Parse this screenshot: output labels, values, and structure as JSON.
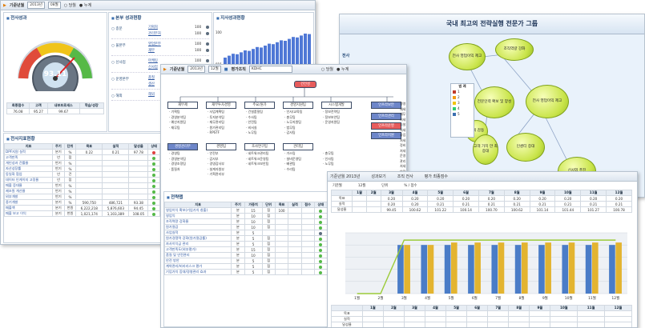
{
  "win1": {
    "header": {
      "label": "기준년월",
      "year": "2013년",
      "month": "08월",
      "opt_unit": "당월",
      "opt_cum": "누계"
    },
    "gauge_title": "전사성과",
    "gauge_value": "93.11",
    "gauge_table": {
      "headers": [
        "최종점수",
        "고객",
        "내부프로세스",
        "학습/성장"
      ],
      "values": [
        "76.08",
        "95.27",
        "99.67",
        ""
      ]
    },
    "dept_title": "본부 성과현황",
    "depts": [
      {
        "name": "○ 종문",
        "rows": [
          {
            "name": "기획처",
            "score": "100"
          },
          {
            "name": "관리부처",
            "score": "100"
          }
        ]
      },
      {
        "name": "○ 울본부",
        "rows": [
          {
            "name": "영업본부",
            "score": "100"
          },
          {
            "name": "재무",
            "score": "100"
          }
        ]
      },
      {
        "name": "○ 신사업",
        "rows": [
          {
            "name": "마케팅",
            "score": "100"
          },
          {
            "name": "신사업",
            "score": "100"
          }
        ]
      },
      {
        "name": "○ 운영본부",
        "rows": [
          {
            "name": "품질",
            "score": "100"
          },
          {
            "name": "생산",
            "score": "100"
          }
        ]
      },
      {
        "name": "○ 해외",
        "rows": [
          {
            "name": "해외",
            "score": "100"
          }
        ]
      }
    ],
    "trend_title": "지사성과현황",
    "trend_ymax": "100",
    "trend_ymin": "815",
    "kpi_title": "전사지표현황",
    "kpi_headers": [
      "지표",
      "주기",
      "단위",
      "목표",
      "실적",
      "달성율",
      "상태"
    ],
    "kpi_rows": [
      [
        "DPF지원 실적",
        "분기",
        "%",
        "0.22",
        "0.21",
        "97.78",
        "r"
      ],
      [
        "고객만족",
        "년",
        "점",
        "",
        "",
        "",
        "g"
      ],
      [
        "개인성과 건률율",
        "반기",
        "%",
        "",
        "",
        "",
        "g"
      ],
      [
        "자산성장률",
        "반기",
        "%",
        "",
        "",
        "",
        "g"
      ],
      [
        "동일화 협업",
        "년",
        "건",
        "",
        "",
        "",
        "g"
      ],
      [
        "데이터 인게이지 고정율",
        "년",
        "점",
        "",
        "",
        "",
        "g"
      ],
      [
        "매출 증대율",
        "반기",
        "%",
        "",
        "",
        "",
        "g"
      ],
      [
        "제조원 개선율",
        "반기",
        "%",
        "",
        "",
        "",
        "g"
      ],
      [
        "외부개발",
        "반기",
        "%",
        "",
        "",
        "",
        "g"
      ],
      [
        "중기개발",
        "분기",
        "%",
        "590,750",
        "486,721",
        "93.38",
        "g"
      ],
      [
        "매출액",
        "분기",
        "천원",
        "6,222,218",
        "5,876,603",
        "94.45",
        "g"
      ],
      [
        "매출 보고 이익",
        "분기",
        "천원",
        "1,021,174",
        "1,103,389",
        "108.05",
        "g"
      ]
    ]
  },
  "win2": {
    "title": "국내 최고의 전략실행 전문가 그룹",
    "side_label": "전사",
    "legend_title": "범 례",
    "legend_items": [
      "1",
      "2",
      "3",
      "4",
      "5"
    ],
    "nodes": [
      "전사 영업이익 제고",
      "조직역량 강화",
      "전문인력 확보 및 양성",
      "전사 영업이익 제고",
      "고객 감동",
      "고객 가치 만 최 증대",
      "인센티 증대",
      "고객의 전 증대",
      "신사업 추진"
    ]
  },
  "win3": {
    "header": {
      "label": "기준년월",
      "year": "2013년",
      "month": "12월",
      "org_label": "평가조직",
      "org": "KDHC",
      "opt_unit": "당월",
      "opt_cum": "누계"
    },
    "root": "건전성",
    "col_heads": [
      "재무제",
      "재무투자경영",
      "주요/원가",
      "경영지원팀",
      "시스템개발",
      "인프라보안"
    ],
    "col_items": [
      [
        "· 기획팀",
        "· 경영분석팀",
        "· 예산지원팀",
        "· 재무팀"
      ],
      [
        "· 사업계획팀",
        "· 투자분석팀",
        "· 재무관리팀",
        "· 원가관리팀",
        "· RPSTF"
      ],
      [
        "· 건설품질팀",
        "· 수사팀",
        "· 안전팀",
        "· 비서실",
        "· 노무팀"
      ],
      [
        "· 인사/교육팀",
        "· 총무팀",
        "· 노무지원팀",
        "· 법무팀",
        "· 감사팀"
      ],
      [
        "· 정보전략팀",
        "· 정보보안팀",
        "· 운영지원팀"
      ],
      []
    ],
    "blue_cols": [
      "인프라보안",
      "인프라관리",
      "인프라운영",
      "인프라지원"
    ],
    "mid_heads": [
      "경영관리부",
      "경영팀",
      "조사연구팀",
      "관리팀"
    ],
    "mid_items": [
      [
        "· 경영팀",
        "· 경영분석팀",
        "· 경영조정팀",
        "· 품질처"
      ],
      [
        "· 안전부",
        "· 감사부",
        "· 경영감사부",
        "· 설계자원부",
        "· 기획관리부"
      ],
      [
        "· 네트워크관리팀",
        "· 네트워크운영팀",
        "· 네트워크보안팀"
      ],
      [
        "· 가스팀",
        "· 설비운영팀",
        "· 배관팀",
        "· 수리팀"
      ],
      [
        "· 총무팀",
        "· 인사팀",
        "· 노무팀"
      ]
    ],
    "right_list": [
      "경영제세",
      "재무처세",
      "시설처세",
      "사업처세",
      "정비처세",
      "운영관리처세",
      "안전처처세",
      "모두운영처세"
    ],
    "kpi_title": "전략맵",
    "kpi_headers": [
      "지표",
      "주기",
      "가중치",
      "단위",
      "목표",
      "실적",
      "점수",
      "상태"
    ],
    "kpi_rows": [
      [
        "영업이익 확보(기업가치 창출)",
        "분",
        "15",
        "점",
        "100",
        "",
        "",
        "g"
      ],
      [
        "영업익",
        "분",
        "10",
        "점",
        "",
        "",
        "",
        "g"
      ],
      [
        "조직역량 강화율",
        "분",
        "10",
        "점",
        "",
        "",
        "",
        "g"
      ],
      [
        "원가절감",
        "분",
        "10",
        "점",
        "",
        "",
        "",
        "g"
      ],
      [
        "사업실적",
        "분",
        "5",
        "",
        "",
        "",
        "",
        ""
      ],
      [
        "원가경쟁력 강화(원가절감률)",
        "분",
        "5",
        "점",
        "",
        "",
        "",
        "g"
      ],
      [
        "자사이익금 관리",
        "분",
        "5",
        "점",
        "",
        "",
        "",
        "g"
      ],
      [
        "고객만족도(외부평가)",
        "분",
        "15",
        "점",
        "",
        "",
        "",
        "g"
      ],
      [
        "품질 및 안전관리",
        "분",
        "10",
        "점",
        "",
        "",
        "",
        "g"
      ],
      [
        "안전 방안",
        "분",
        "5",
        "점",
        "",
        "",
        "",
        "g"
      ],
      [
        "계약관리/비리리스크 평가",
        "분",
        "5",
        "점",
        "",
        "",
        "",
        "g"
      ],
      [
        "기업가치 증대/경영관리 효과",
        "분",
        "5",
        "점",
        "",
        "",
        "",
        "g"
      ]
    ]
  },
  "win4": {
    "header": [
      "기준년월 2013년",
      "성과보기",
      "조직 전사",
      "평가 최종점수"
    ],
    "info": [
      "기준월",
      "12월",
      "단위",
      "% / 점수"
    ],
    "months": [
      "1월",
      "2월",
      "3월",
      "4월",
      "5월",
      "6월",
      "7월",
      "8월",
      "9월",
      "10월",
      "11월",
      "12월"
    ],
    "row_labels": [
      "목표",
      "실적",
      "달성율"
    ],
    "table_rows": [
      [
        "",
        "",
        "0.20",
        "0.20",
        "0.20",
        "0.20",
        "0.20",
        "0.20",
        "0.20",
        "0.20",
        "0.20",
        "0.20"
      ],
      [
        "",
        "",
        "0.20",
        "0.20",
        "0.21",
        "0.21",
        "0.21",
        "0.21",
        "0.21",
        "0.21",
        "0.21",
        "0.21"
      ],
      [
        "",
        "",
        "99.45",
        "100.62",
        "101.22",
        "100.14",
        "100.70",
        "100.62",
        "101.14",
        "101.44",
        "101.27",
        "100.78"
      ]
    ],
    "bottom_labels": [
      "목표",
      "실적",
      "달성율"
    ]
  },
  "chart_data": {
    "type": "bar",
    "categories": [
      "1월",
      "2월",
      "3월",
      "4월",
      "5월",
      "6월",
      "7월",
      "8월",
      "9월",
      "10월",
      "11월",
      "12월"
    ],
    "series": [
      {
        "values": [
          0,
          0,
          0.2,
          0.2,
          0.2,
          0.2,
          0.2,
          0.2,
          0.2,
          0.2,
          0.2,
          0.2
        ]
      },
      {
        "values": [
          0,
          0,
          0.2,
          0.2,
          0.21,
          0.21,
          0.21,
          0.21,
          0.21,
          0.21,
          0.21,
          0.21
        ]
      }
    ],
    "line": [
      0,
      0,
      0.22,
      0.22,
      0.22,
      0.22,
      0.22,
      0.22,
      0.22,
      0.22,
      0.22,
      0.22
    ],
    "ylim": [
      0,
      0.25
    ],
    "colors": {
      "target": "#4a7cc7",
      "actual": "#e3b430",
      "line": "#9ccb3a"
    }
  }
}
